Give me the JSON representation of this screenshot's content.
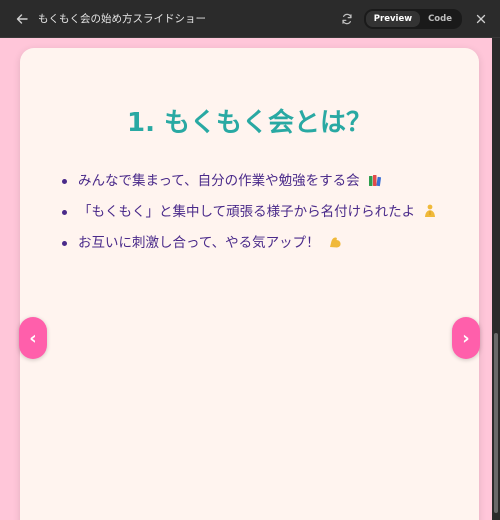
{
  "window": {
    "title": "もくもく会の始め方スライドショー",
    "toggle": {
      "preview_label": "Preview",
      "code_label": "Code",
      "selected": "Preview"
    }
  },
  "slide": {
    "title": "1. もくもく会とは？",
    "bullets": [
      "みんなで集まって、自分の作業や勉強をする会",
      "「もくもく」と集中して頑張る様子から名付けられたよ",
      "お互いに刺激し合って、やる気アップ！"
    ],
    "bullet_icons": [
      "books-icon",
      "praying-person-icon",
      "flexed-biceps-icon"
    ]
  },
  "nav": {
    "prev_glyph": "‹",
    "next_glyph": "›"
  },
  "colors": {
    "accent": "#ff5fab",
    "title": "#29a9a3",
    "text": "#4a2a8a",
    "background": "#ffc6d9",
    "slide": "#fff4ef"
  }
}
